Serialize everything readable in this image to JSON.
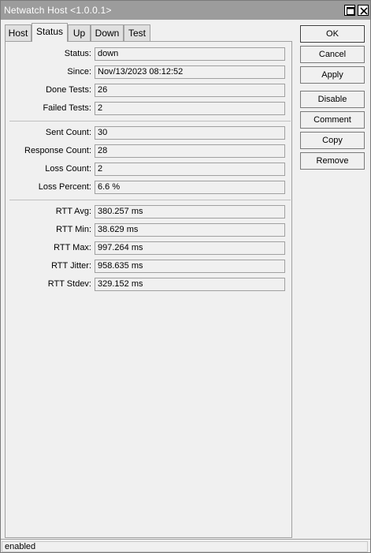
{
  "window": {
    "title": "Netwatch Host <1.0.0.1>"
  },
  "tabs": [
    {
      "label": "Host",
      "active": false
    },
    {
      "label": "Status",
      "active": true
    },
    {
      "label": "Up",
      "active": false
    },
    {
      "label": "Down",
      "active": false
    },
    {
      "label": "Test",
      "active": false
    }
  ],
  "status": {
    "status": {
      "label": "Status:",
      "value": "down"
    },
    "since": {
      "label": "Since:",
      "value": "Nov/13/2023 08:12:52"
    },
    "done_tests": {
      "label": "Done Tests:",
      "value": "26"
    },
    "failed_tests": {
      "label": "Failed Tests:",
      "value": "2"
    },
    "sent_count": {
      "label": "Sent Count:",
      "value": "30"
    },
    "response_count": {
      "label": "Response Count:",
      "value": "28"
    },
    "loss_count": {
      "label": "Loss Count:",
      "value": "2"
    },
    "loss_percent": {
      "label": "Loss Percent:",
      "value": "6.6 %"
    },
    "rtt_avg": {
      "label": "RTT Avg:",
      "value": "380.257 ms"
    },
    "rtt_min": {
      "label": "RTT Min:",
      "value": "38.629 ms"
    },
    "rtt_max": {
      "label": "RTT Max:",
      "value": "997.264 ms"
    },
    "rtt_jitter": {
      "label": "RTT Jitter:",
      "value": "958.635 ms"
    },
    "rtt_stdev": {
      "label": "RTT Stdev:",
      "value": "329.152 ms"
    }
  },
  "buttons": {
    "ok": "OK",
    "cancel": "Cancel",
    "apply": "Apply",
    "disable": "Disable",
    "comment": "Comment",
    "copy": "Copy",
    "remove": "Remove"
  },
  "statusbar": {
    "text": "enabled"
  },
  "colors": {
    "titlebar": "#9c9c9c",
    "background": "#f0f0f0"
  }
}
